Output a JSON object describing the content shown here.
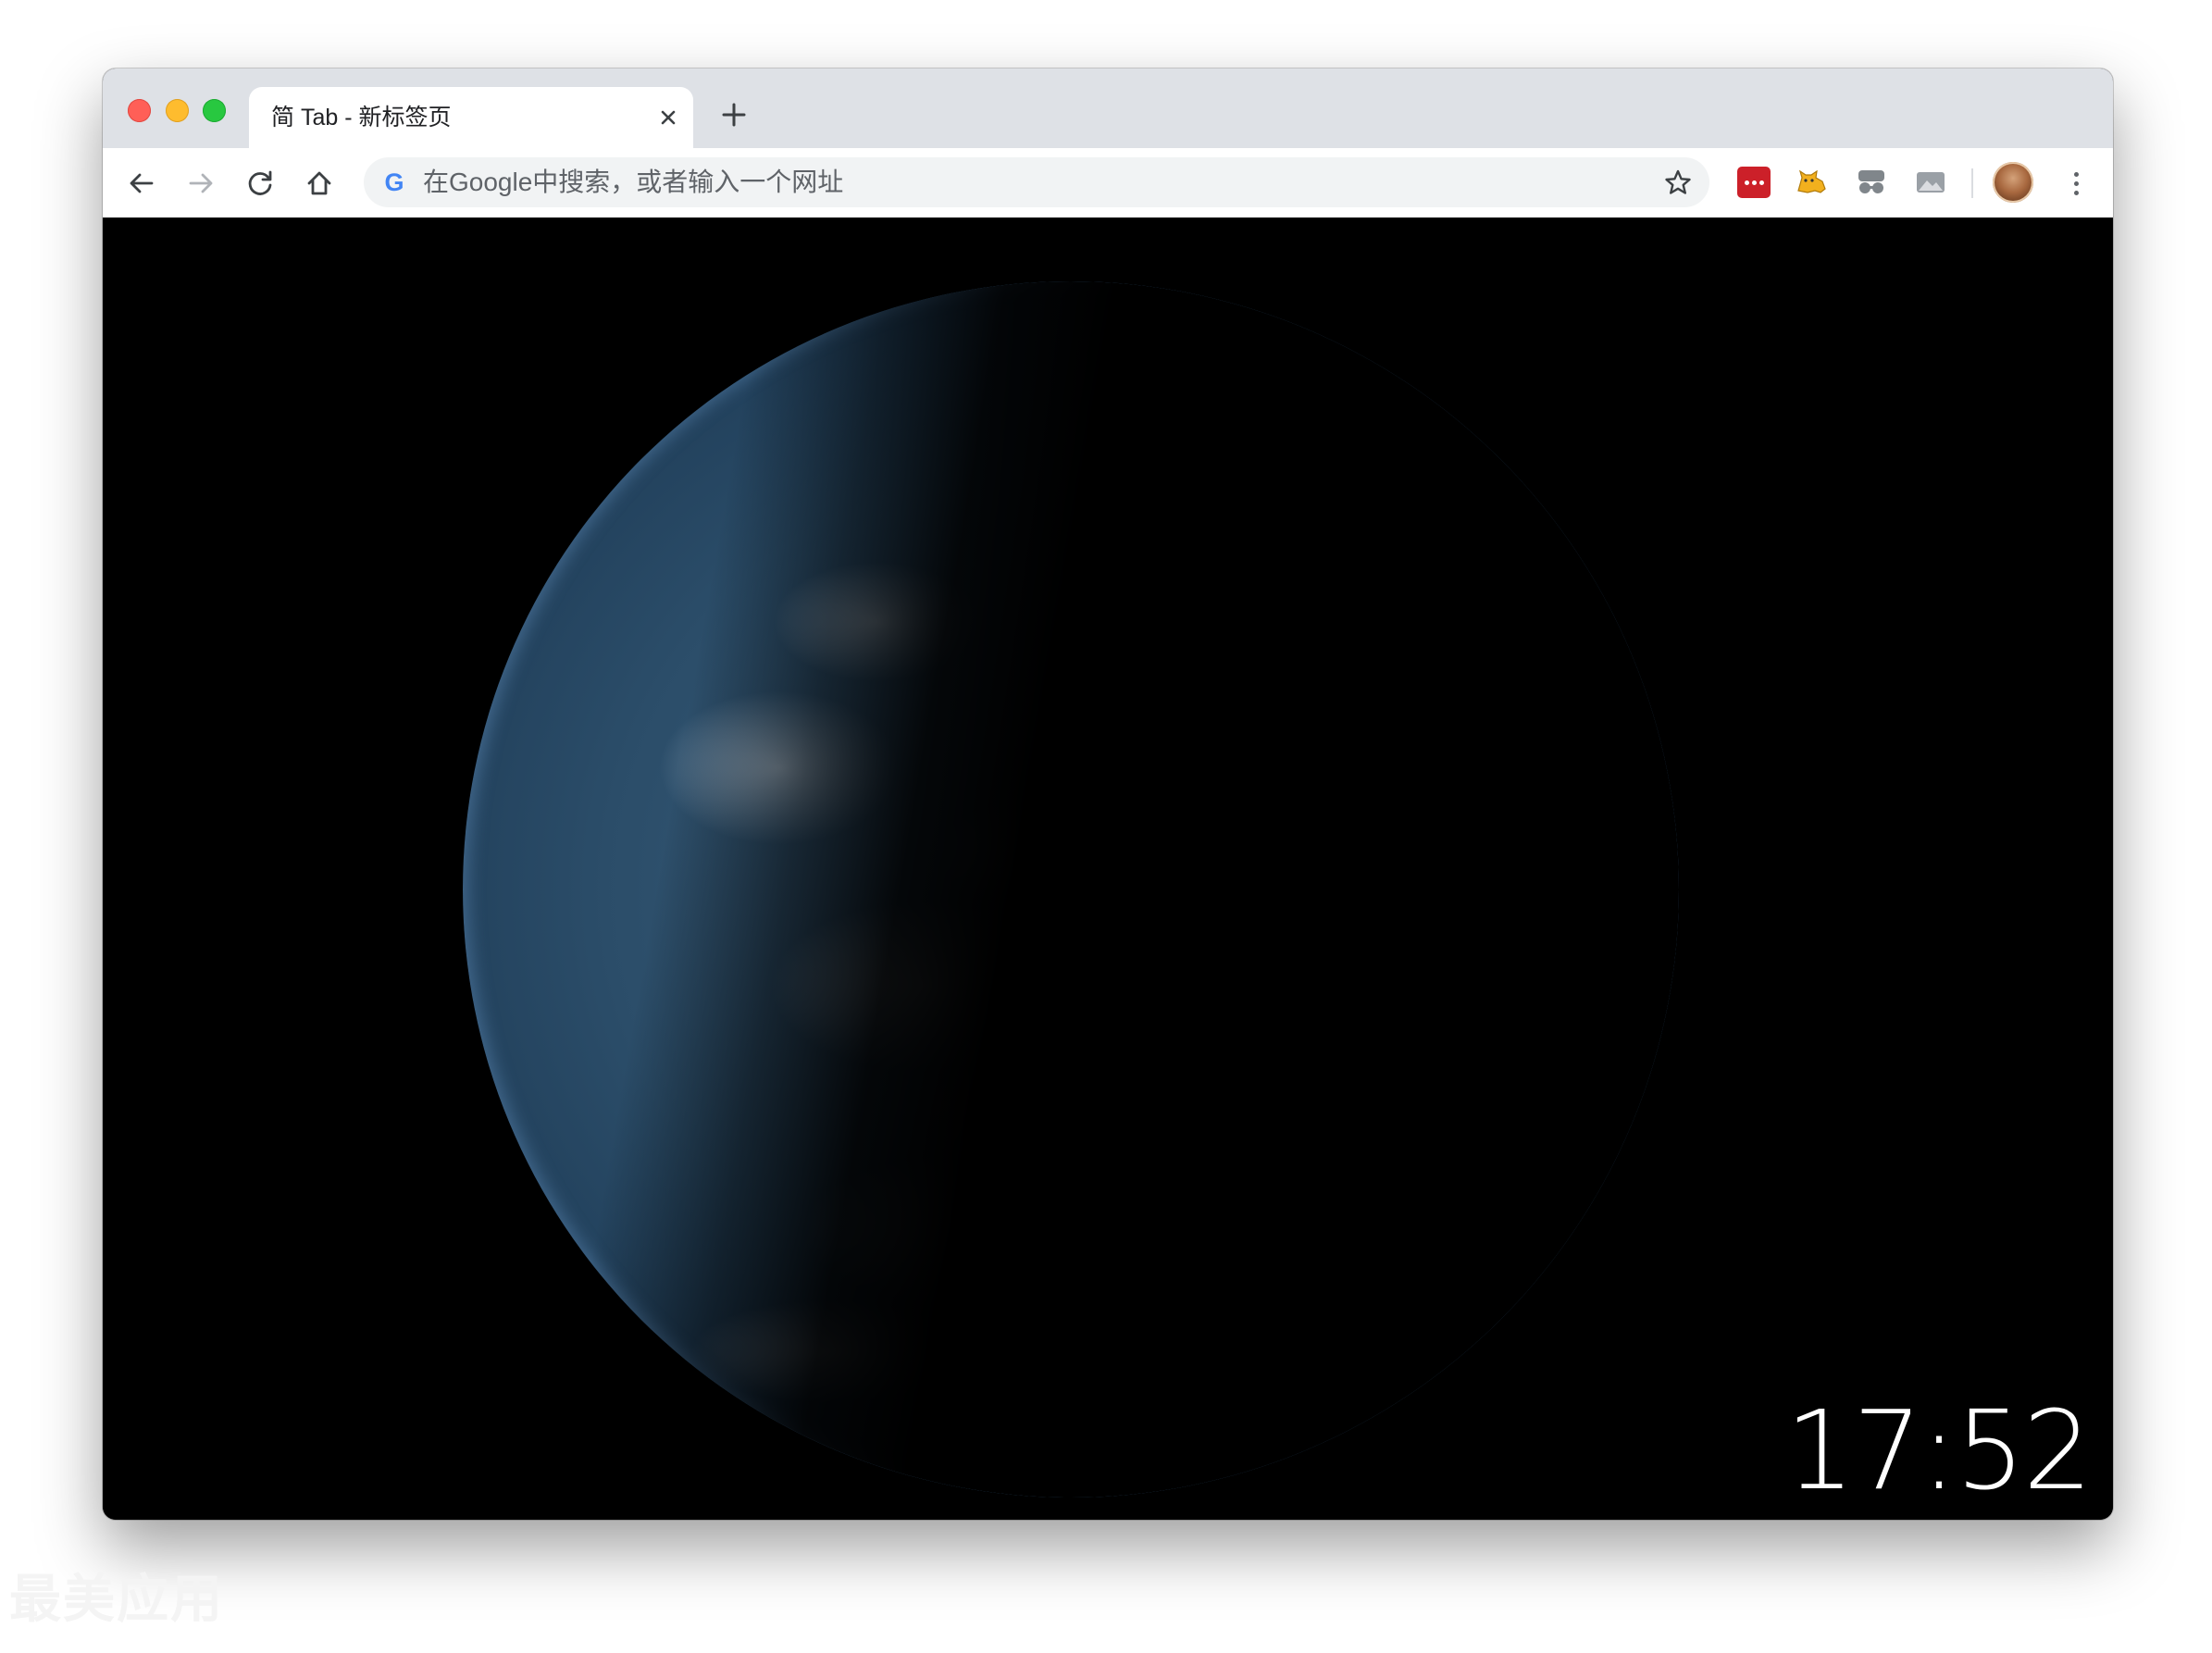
{
  "browser": {
    "tab": {
      "title": "简 Tab - 新标签页",
      "close_icon": "close-icon"
    },
    "new_tab_icon": "plus-icon",
    "nav": {
      "back_icon": "arrow-left-icon",
      "forward_icon": "arrow-right-icon",
      "reload_icon": "reload-icon",
      "home_icon": "home-icon"
    },
    "omnibox": {
      "provider_icon": "google-g-icon",
      "provider_letter": "G",
      "placeholder": "在Google中搜索，或者输入一个网址",
      "bookmark_icon": "star-icon"
    },
    "extensions": [
      "lastpass-icon",
      "cat-icon",
      "incognito-icon",
      "image-icon"
    ],
    "profile_icon": "avatar",
    "menu_icon": "more-vertical-icon"
  },
  "page": {
    "background": "earth-night-side-image",
    "clock": "17:52"
  },
  "watermark": "最美应用",
  "colors": {
    "tabstrip": "#dee1e6",
    "omnibox": "#f1f3f4",
    "page_background": "#000000",
    "lastpass_red": "#cc2029",
    "close_red": "#ff5f57",
    "minimize_yellow": "#febc2e",
    "zoom_green": "#28c840"
  }
}
